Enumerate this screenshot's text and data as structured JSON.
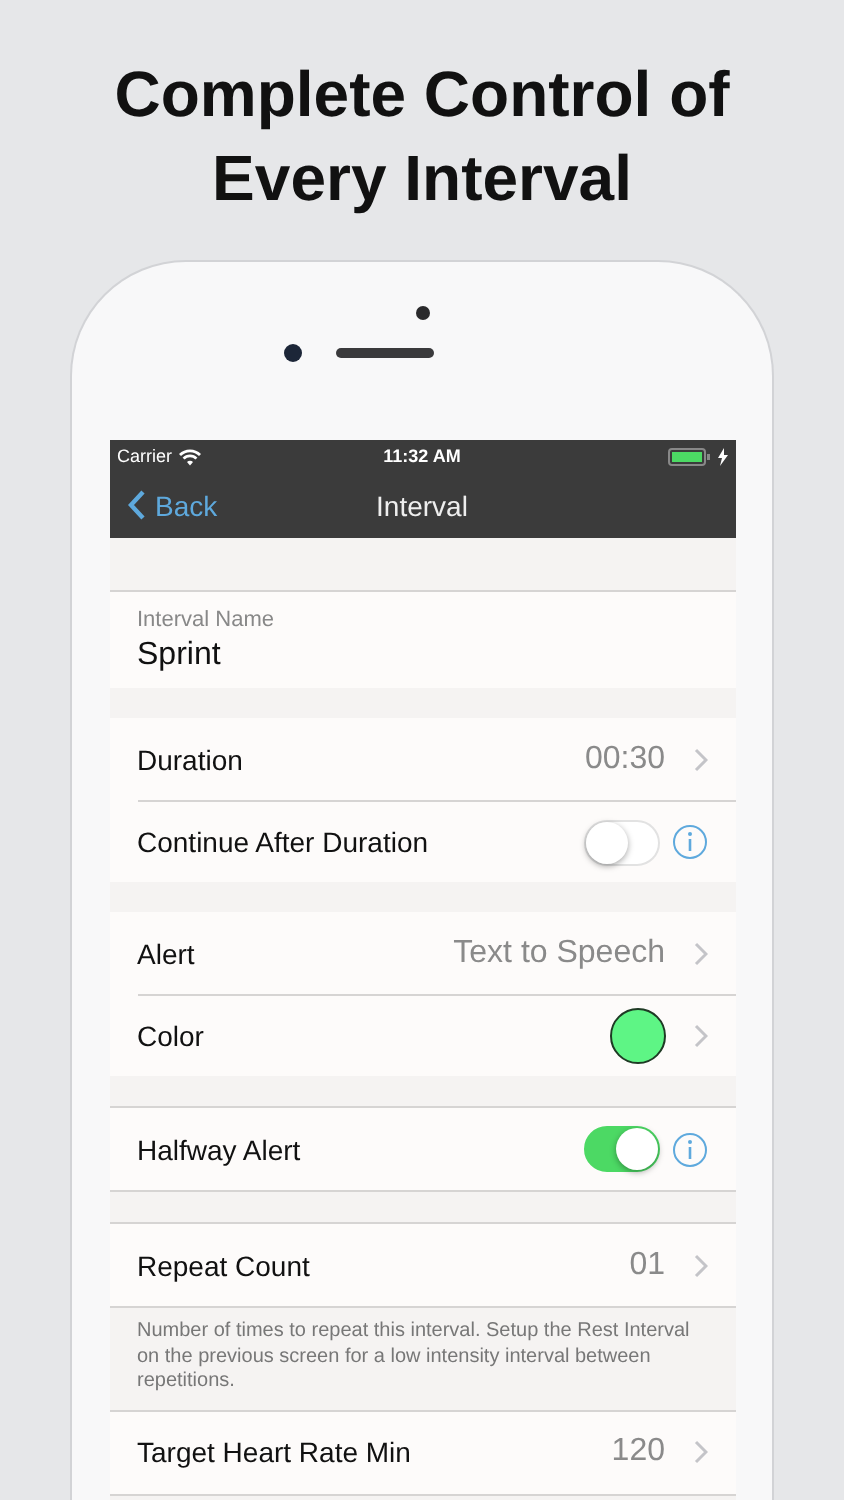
{
  "headline": [
    "Complete Control of",
    "Every Interval"
  ],
  "status_bar": {
    "carrier": "Carrier",
    "time": "11:32 AM",
    "charging": true
  },
  "nav": {
    "back": "Back",
    "title": "Interval"
  },
  "sections": [
    {
      "rows": [
        {
          "kind": "text_field",
          "label": "Interval Name",
          "value": "Sprint"
        }
      ]
    },
    {
      "rows": [
        {
          "kind": "disclosure",
          "label": "Duration",
          "value": "00:30"
        },
        {
          "kind": "toggle",
          "label": "Continue After Duration",
          "on": false
        }
      ]
    },
    {
      "rows": [
        {
          "kind": "disclosure",
          "label": "Alert",
          "value": "Text to Speech"
        },
        {
          "kind": "color",
          "label": "Color",
          "color": "#5ef585"
        }
      ]
    },
    {
      "rows": [
        {
          "kind": "toggle",
          "label": "Halfway Alert",
          "on": true
        }
      ]
    },
    {
      "rows": [
        {
          "kind": "disclosure",
          "label": "Repeat Count",
          "value": "01"
        }
      ],
      "footer": "Number of times to repeat this interval. Setup the Rest Interval on the previous screen for a low intensity interval between repetitions."
    },
    {
      "rows": [
        {
          "kind": "disclosure",
          "label": "Target Heart Rate Min",
          "value": "120"
        }
      ]
    }
  ]
}
